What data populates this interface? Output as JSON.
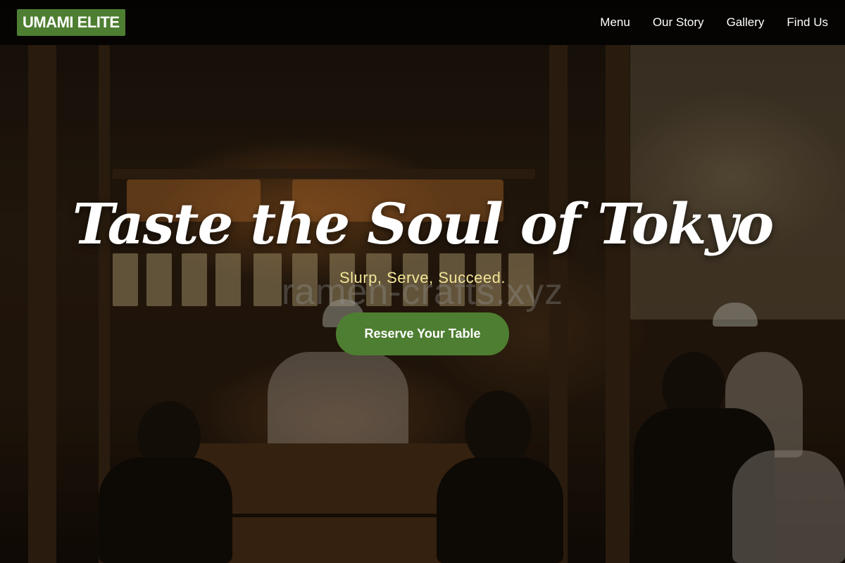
{
  "brand": {
    "name": "UMAMI ELITE",
    "color": "#4e7e31"
  },
  "nav": {
    "items": [
      {
        "label": "Menu"
      },
      {
        "label": "Our Story"
      },
      {
        "label": "Gallery"
      },
      {
        "label": "Find Us"
      }
    ]
  },
  "hero": {
    "title": "Taste the Soul of Tokyo",
    "tagline": "Slurp, Serve, Succeed.",
    "watermark": "ramen-crafts.xyz",
    "cta_label": "Reserve Your Table",
    "background_image": "restaurant-interior-photo",
    "tagline_color": "#f3e597"
  }
}
